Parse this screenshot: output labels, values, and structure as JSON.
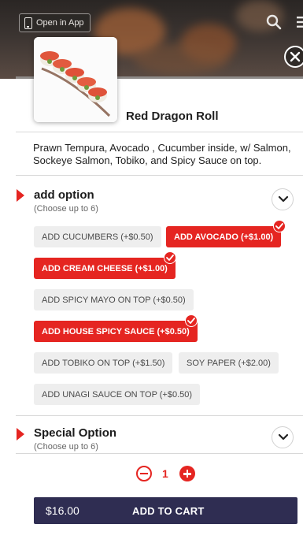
{
  "header": {
    "open_in_app": "Open in App"
  },
  "product": {
    "name": "Red Dragon Roll",
    "description": "Prawn Tempura, Avocado , Cucumber inside, w/ Salmon, Sockeye Salmon, Tobiko, and Spicy Sauce on top."
  },
  "sections": [
    {
      "title": "add option",
      "subtitle": "(Choose up to 6)",
      "options": [
        {
          "label": "ADD CUCUMBERS (+$0.50)",
          "selected": false
        },
        {
          "label": "ADD AVOCADO (+$1.00)",
          "selected": true
        },
        {
          "label": "ADD CREAM CHEESE (+$1.00)",
          "selected": true
        },
        {
          "label": "ADD SPICY MAYO ON TOP (+$0.50)",
          "selected": false
        },
        {
          "label": "ADD HOUSE SPICY SAUCE (+$0.50)",
          "selected": true
        },
        {
          "label": "ADD TOBIKO ON TOP (+$1.50)",
          "selected": false
        },
        {
          "label": "SOY PAPER (+$2.00)",
          "selected": false
        },
        {
          "label": "ADD UNAGI SAUCE ON TOP (+$0.50)",
          "selected": false
        }
      ]
    },
    {
      "title": "Special Option",
      "subtitle": "(Choose up to 6)"
    }
  ],
  "quantity": "1",
  "cart": {
    "price": "$16.00",
    "label": "ADD TO CART"
  },
  "colors": {
    "accent": "#e52521",
    "cart_bg": "#2f2d52",
    "option_bg": "#eeeeee"
  },
  "icons": [
    "phone-icon",
    "search-icon",
    "menu-icon",
    "close-icon",
    "chevron-down-icon",
    "check-icon",
    "minus-icon",
    "plus-icon"
  ]
}
